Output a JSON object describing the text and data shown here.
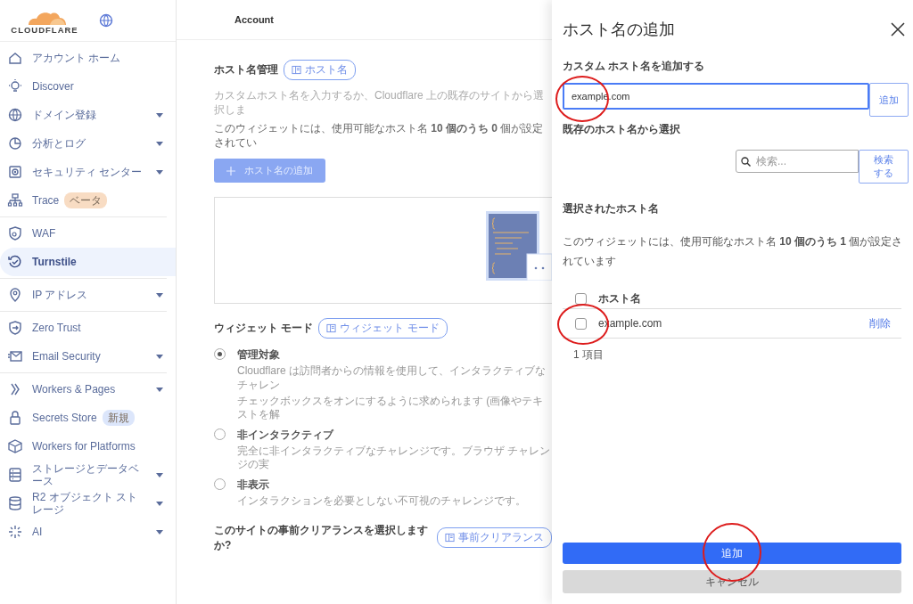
{
  "sidebar": {
    "logo": "CLOUDFLARE",
    "sections": [
      [
        {
          "label": "アカウント ホーム",
          "expandable": false,
          "selected": false
        },
        {
          "label": "Discover",
          "expandable": false,
          "selected": false
        },
        {
          "label": "ドメイン登録",
          "expandable": true,
          "selected": false
        },
        {
          "label": "分析とログ",
          "expandable": true,
          "selected": false
        },
        {
          "label": "セキュリティ センター",
          "expandable": true,
          "selected": false
        },
        {
          "label": "Trace",
          "expandable": false,
          "selected": false,
          "badge": {
            "label": "ベータ",
            "color": "#f8dcc3"
          }
        }
      ],
      [
        {
          "label": "WAF",
          "expandable": false,
          "selected": false
        },
        {
          "label": "Turnstile",
          "expandable": false,
          "selected": true
        }
      ],
      [
        {
          "label": "IP アドレス",
          "expandable": true,
          "selected": false
        }
      ],
      [
        {
          "label": "Zero Trust",
          "expandable": false,
          "selected": false
        },
        {
          "label": "Email Security",
          "expandable": true,
          "selected": false
        }
      ],
      [
        {
          "label": "Workers & Pages",
          "expandable": true,
          "selected": false
        },
        {
          "label": "Secrets Store",
          "expandable": false,
          "selected": false,
          "badge": {
            "label": "新規",
            "color": "#dce6fb"
          }
        },
        {
          "label": "Workers for Platforms",
          "expandable": false,
          "selected": false
        },
        {
          "label": "ストレージとデータベース",
          "expandable": true,
          "selected": false
        },
        {
          "label": "R2 オブジェクト ストレージ",
          "expandable": true,
          "selected": false
        },
        {
          "label": "AI",
          "expandable": true,
          "selected": false
        }
      ]
    ]
  },
  "top_bar": {
    "title": "Account"
  },
  "hostname_section": {
    "heading": "ホスト名管理",
    "doc_link": "ホスト名",
    "description": "カスタムホスト名を入力するか、Cloudflare 上の既存のサイトから選択しま",
    "count_text": "このウィジェットには、使用可能なホスト名 **10 個のうち 0** 個が設定されてい",
    "add_button": {
      "label": "ホスト名の追加",
      "disabled": true
    }
  },
  "widget_mode": {
    "heading": "ウィジェット モード",
    "doc_link": "ウィジェット モード",
    "options": [
      {
        "label": "管理対象",
        "selected": true,
        "description_lines": [
          "Cloudflare は訪問者からの情報を使用して、インタラクティブなチャレン",
          "チェックボックスをオンにするように求められます (画像やテキストを解"
        ]
      },
      {
        "label": "非インタラクティブ",
        "selected": false,
        "description_lines": [
          "完全に非インタラクティブなチャレンジです。ブラウザ チャレンジの実"
        ]
      },
      {
        "label": "非表示",
        "selected": false,
        "description_lines": [
          "インタラクションを必要としない不可視のチャレンジです。"
        ]
      }
    ]
  },
  "clearance": {
    "heading": "このサイトの事前クリアランスを選択しますか?",
    "doc_link": "事前クリアランス"
  },
  "drawer": {
    "title": "ホスト名の追加",
    "custom_label": "カスタム ホスト名を追加する",
    "custom_value": "example.com",
    "custom_add_button": "追加",
    "existing_label": "既存のホスト名から選択",
    "search_placeholder": "検索...",
    "search_button": "検索する",
    "selected_label": "選択されたホスト名",
    "selected_count_text": "このウィジェットには、使用可能なホスト名 **10 個のうち 1** 個が設定されています",
    "table": {
      "header": {
        "label": "ホスト名",
        "checked": false
      },
      "rows": [
        {
          "hostname": "example.com",
          "action": "削除",
          "checked": false
        }
      ]
    },
    "item_count": "1 項目",
    "primary_button": "追加",
    "cancel_button": "キャンセル"
  }
}
